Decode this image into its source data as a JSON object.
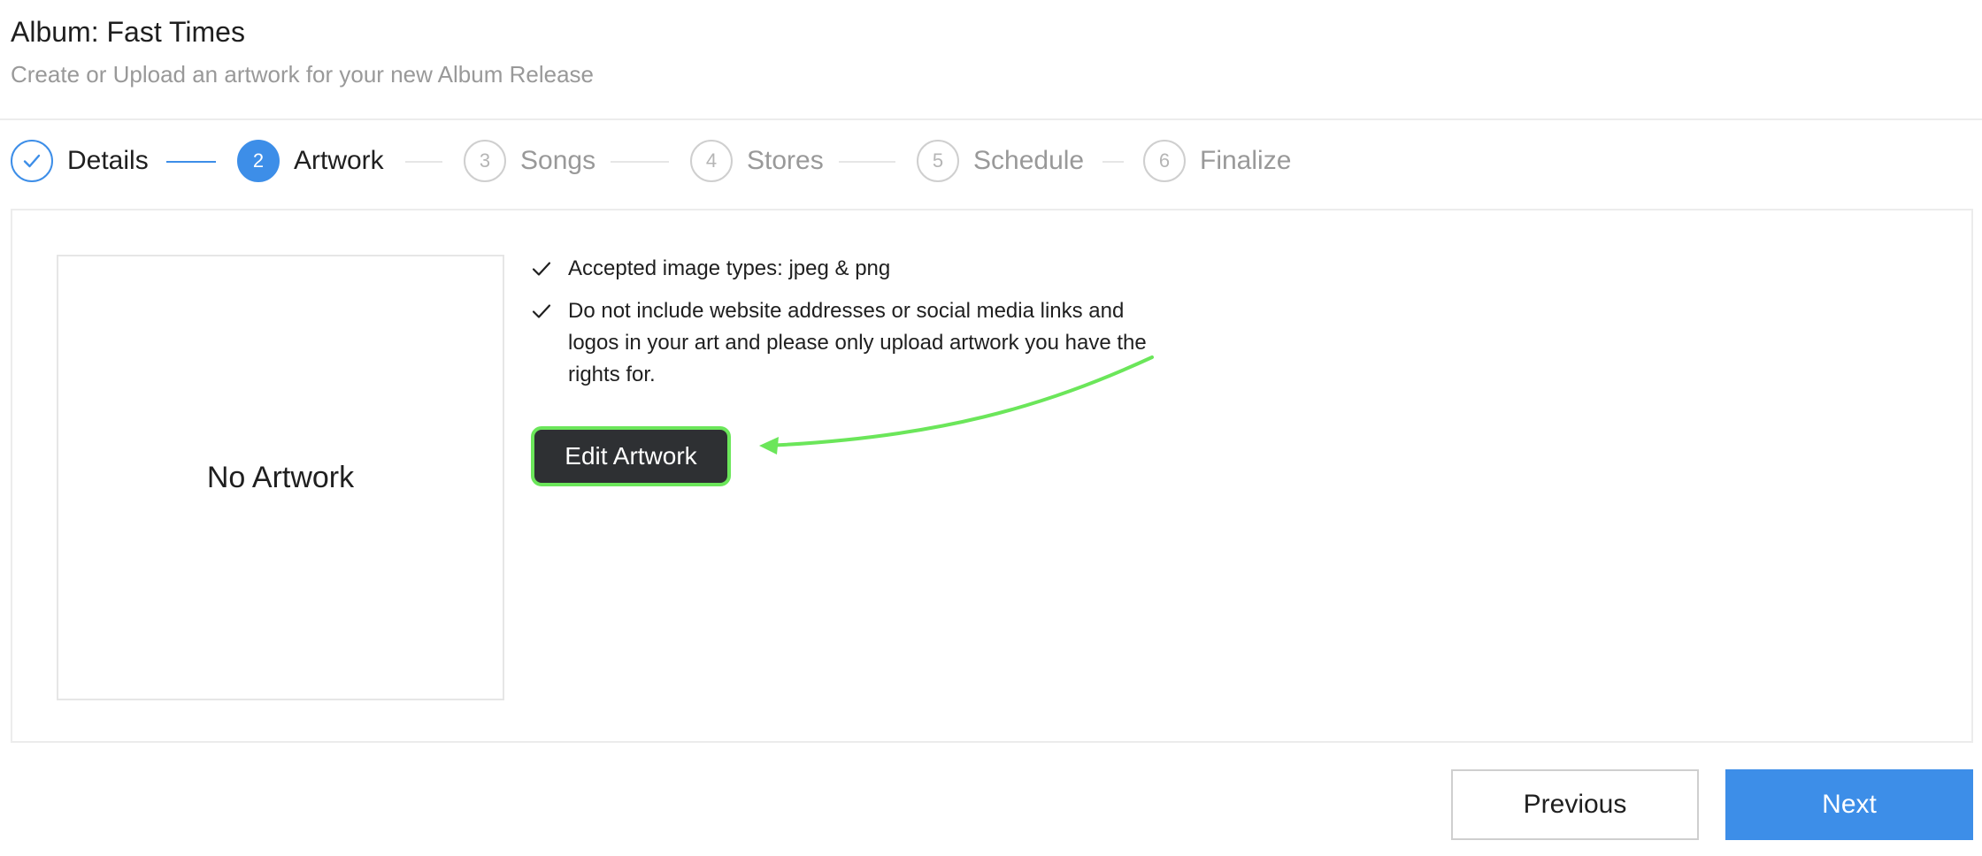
{
  "header": {
    "title": "Album: Fast Times",
    "subtitle": "Create or Upload an artwork for your new Album Release"
  },
  "stepper": {
    "steps": [
      {
        "number": "",
        "label": "Details",
        "state": "done",
        "icon": "check-icon"
      },
      {
        "number": "2",
        "label": "Artwork",
        "state": "active"
      },
      {
        "number": "3",
        "label": "Songs",
        "state": "pending"
      },
      {
        "number": "4",
        "label": "Stores",
        "state": "pending"
      },
      {
        "number": "5",
        "label": "Schedule",
        "state": "pending"
      },
      {
        "number": "6",
        "label": "Finalize",
        "state": "pending"
      }
    ]
  },
  "artwork": {
    "placeholder": "No Artwork"
  },
  "requirements": [
    "Accepted image types: jpeg & png",
    "Do not include website addresses or social media links and logos in your art and please only upload artwork you have the rights for."
  ],
  "actions": {
    "edit_label": "Edit Artwork",
    "previous_label": "Previous",
    "next_label": "Next"
  },
  "colors": {
    "accent": "#3d8ee8",
    "highlight": "#6be65a",
    "dark_button": "#2e3033"
  }
}
